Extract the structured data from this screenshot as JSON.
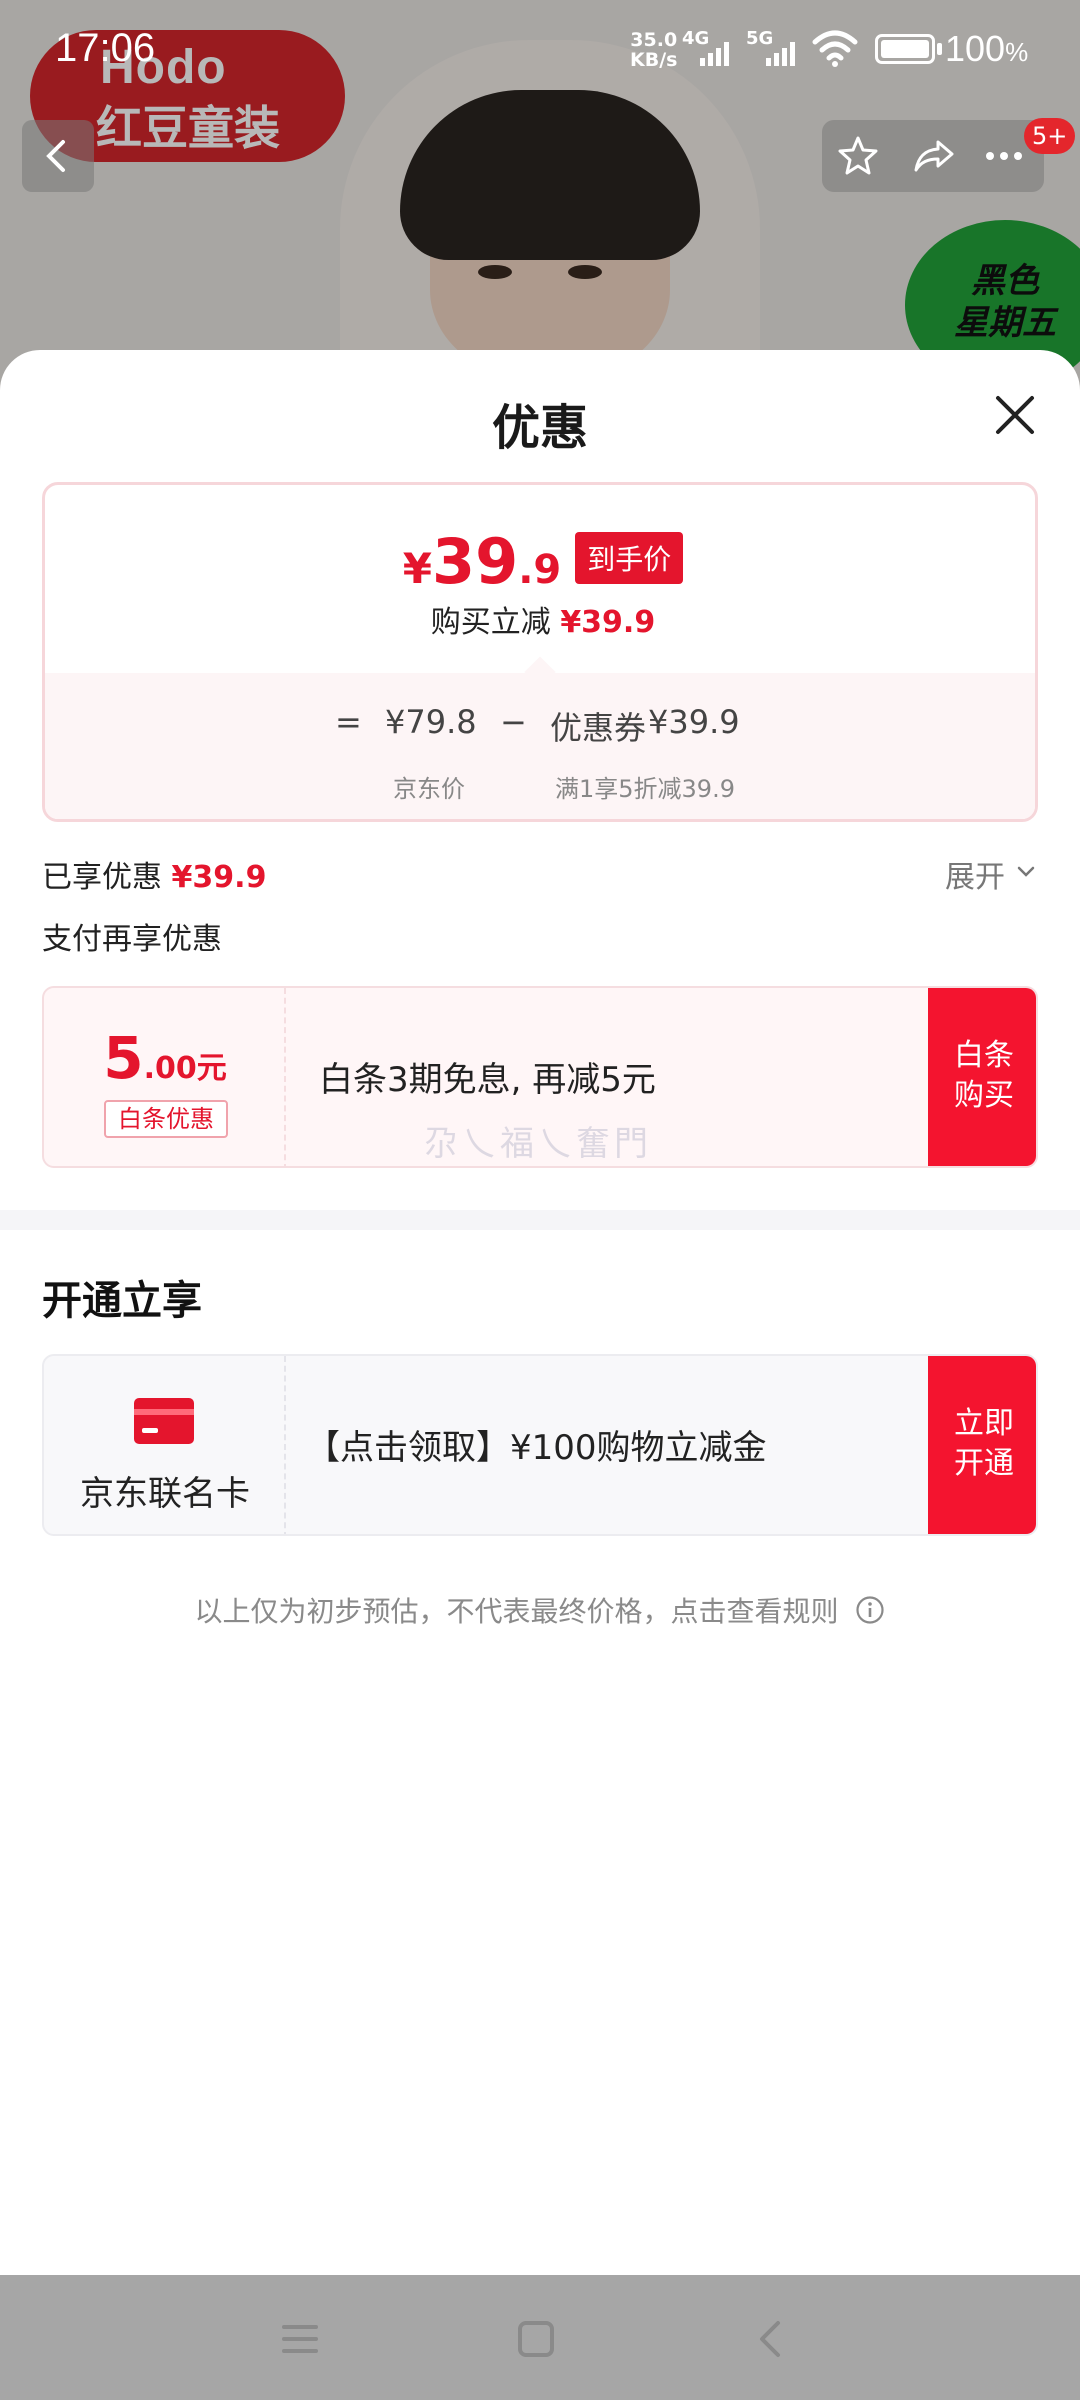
{
  "status_bar": {
    "time": "17:06",
    "net_speed_value": "35.0",
    "net_speed_unit": "KB/s",
    "sim1_type": "4G",
    "sim2_type": "5G",
    "battery_percent": "100",
    "battery_unit": "%"
  },
  "background_page": {
    "brand_name_en": "Hodo",
    "brand_name_cn": "红豆童装",
    "cart_badge": "5+",
    "promo_sticker_line1": "黑色",
    "promo_sticker_line2": "星期五"
  },
  "sheet": {
    "title": "优惠",
    "price_card": {
      "final_yen": "¥",
      "final_int": "39",
      "final_dec": ".9",
      "final_tag": "到手价",
      "reduce_label": "购买立减",
      "reduce_amount": "¥39.9",
      "equals": "=",
      "jd_price": "¥79.8",
      "minus": "−",
      "coupon_label": "优惠券",
      "coupon_amount": "¥39.9",
      "jd_price_label": "京东价",
      "coupon_rule": "满1享5折减39.9"
    },
    "enjoyed_label": "已享优惠",
    "enjoyed_amount": "¥39.9",
    "expand_label": "展开",
    "pay_section_title": "支付再享优惠",
    "baitiao_offer": {
      "amount_int": "5",
      "amount_dec": ".00",
      "amount_unit": "元",
      "tag": "白条优惠",
      "description": "白条3期免息, 再减5元",
      "button_line1": "白条",
      "button_line2": "购买",
      "watermark": "尕乀福乀奮門"
    },
    "open_section_title": "开通立享",
    "cobrand_card": {
      "name": "京东联名卡",
      "description": "【点击领取】¥100购物立减金",
      "button_line1": "立即",
      "button_line2": "开通"
    },
    "disclaimer": "以上仅为初步预估，不代表最终价格，点击查看规则"
  },
  "colors": {
    "accent_red": "#e4152d",
    "button_red": "#f4142f",
    "card_border_pink": "#f6d6da"
  }
}
